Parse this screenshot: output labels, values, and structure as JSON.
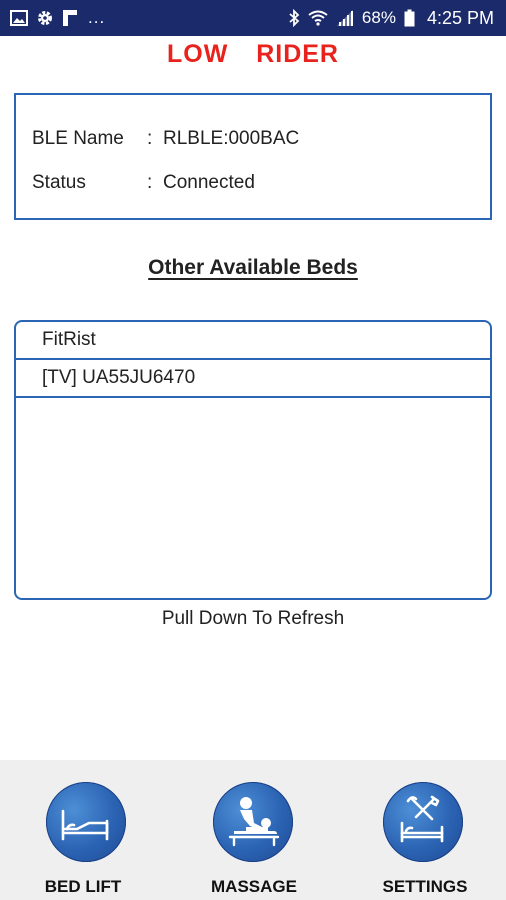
{
  "status_bar": {
    "battery_percent": "68%",
    "time": "4:25 PM",
    "overflow": "...",
    "icons": [
      "image-icon",
      "gear-icon",
      "flipboard-icon",
      "bluetooth-icon",
      "wifi-icon",
      "signal-icon",
      "battery-icon"
    ]
  },
  "app": {
    "title": "LOW  RIDER"
  },
  "device_info": {
    "ble_name_label": "BLE Name",
    "ble_name_value": "RLBLE:000BAC",
    "status_label": "Status",
    "status_value": "Connected",
    "separator": ":"
  },
  "beds": {
    "heading": "Other Available Beds",
    "items": [
      "FitRist",
      "[TV] UA55JU6470"
    ],
    "refresh_hint": "Pull Down To Refresh"
  },
  "bottom_nav": {
    "items": [
      {
        "label": "BED LIFT",
        "icon": "bed-lift-icon"
      },
      {
        "label": "MASSAGE",
        "icon": "massage-icon"
      },
      {
        "label": "SETTINGS",
        "icon": "settings-tools-icon"
      }
    ]
  },
  "colors": {
    "status_bar": "#1b2a6b",
    "title": "#e8221c",
    "border": "#2a66b5",
    "nav_background": "#efefef"
  }
}
